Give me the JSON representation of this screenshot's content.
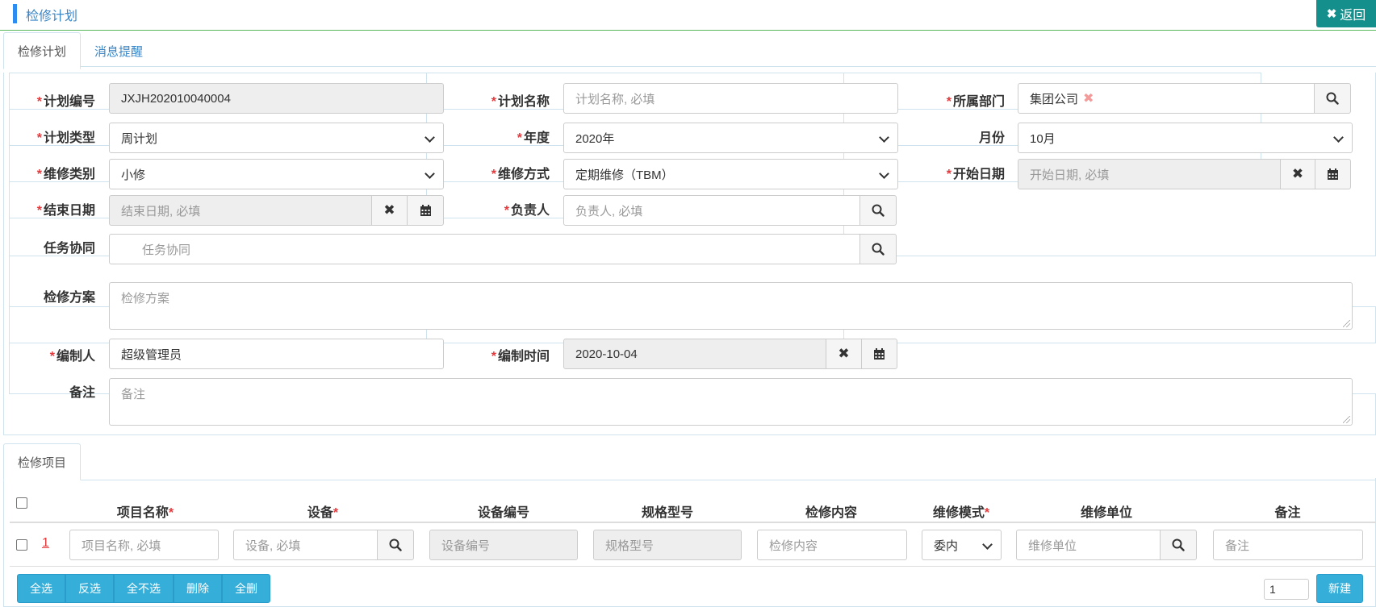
{
  "header": {
    "title": "检修计划",
    "back_label": "返回"
  },
  "tabs_top": [
    {
      "label": "检修计划",
      "active": true
    },
    {
      "label": "消息提醒",
      "active": false
    }
  ],
  "form": {
    "plan_no": {
      "label": "计划编号",
      "value": "JXJH202010040004"
    },
    "plan_name": {
      "label": "计划名称",
      "placeholder": "计划名称, 必填"
    },
    "department": {
      "label": "所属部门",
      "value": "集团公司"
    },
    "plan_type": {
      "label": "计划类型",
      "value": "周计划"
    },
    "year": {
      "label": "年度",
      "value": "2020年"
    },
    "month": {
      "label": "月份",
      "value": "10月"
    },
    "repair_category": {
      "label": "维修类别",
      "value": "小修"
    },
    "repair_method": {
      "label": "维修方式",
      "value": "定期维修（TBM）"
    },
    "start_date": {
      "label": "开始日期",
      "placeholder": "开始日期, 必填"
    },
    "end_date": {
      "label": "结束日期",
      "placeholder": "结束日期, 必填"
    },
    "owner": {
      "label": "负责人",
      "placeholder": "负责人, 必填"
    },
    "task_collab": {
      "label": "任务协同",
      "placeholder": "任务协同"
    },
    "repair_plan": {
      "label": "检修方案",
      "placeholder": "检修方案"
    },
    "author": {
      "label": "编制人",
      "value": "超级管理员"
    },
    "author_time": {
      "label": "编制时间",
      "value": "2020-10-04"
    },
    "remark": {
      "label": "备注",
      "placeholder": "备注"
    }
  },
  "tabs_bottom": [
    {
      "label": "检修项目",
      "active": true
    }
  ],
  "table": {
    "columns": [
      "项目名称",
      "设备",
      "设备编号",
      "规格型号",
      "检修内容",
      "维修模式",
      "维修单位",
      "备注"
    ],
    "row": {
      "index": "1",
      "item_name_ph": "项目名称, 必填",
      "device_ph": "设备, 必填",
      "device_no_ph": "设备编号",
      "spec_ph": "规格型号",
      "content_ph": "检修内容",
      "mode_value": "委内",
      "unit_ph": "维修单位",
      "remark_ph": "备注"
    }
  },
  "toolbar": {
    "buttons": [
      "全选",
      "反选",
      "全不选",
      "删除",
      "全删"
    ],
    "page_value": "1",
    "new_label": "新建"
  },
  "colors": {
    "accent": "#2d8cf0",
    "back_button": "#148f8b",
    "action_button": "#35aed9",
    "required": "#e4393c"
  },
  "icons": {
    "search": "search-icon",
    "clear": "times-icon",
    "calendar": "calendar-icon",
    "back": "times-icon"
  }
}
